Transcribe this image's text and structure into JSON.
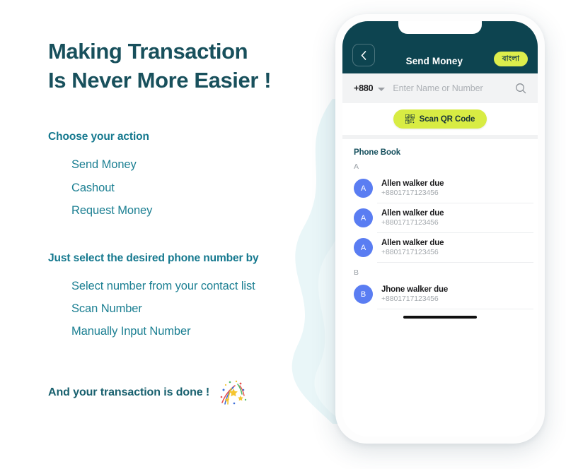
{
  "colors": {
    "headline": "#18505c",
    "section_title": "#14788e",
    "list_item": "#1b7f92",
    "closing": "#18606e",
    "app_header_bg": "#0d4450",
    "accent_lime": "#d8ec43",
    "lang_pill_bg": "#ddee4c",
    "avatar_blue": "#5a7df2",
    "background_blob": "#eaf6f8"
  },
  "left": {
    "headline": "Making Transaction\nIs Never More Easier !",
    "sections": [
      {
        "title": "Choose your action",
        "items": [
          "Send Money",
          "Cashout",
          "Request Money"
        ]
      },
      {
        "title": "Just select the desired phone number by",
        "items": [
          "Select number from your contact list",
          "Scan Number",
          "Manually Input Number"
        ]
      }
    ],
    "closing_text": "And your transaction is done !",
    "closing_icon": "confetti-icon"
  },
  "phone": {
    "header": {
      "back_icon": "chevron-left-icon",
      "title": "Send Money",
      "language_pill": "বাংলা"
    },
    "search": {
      "country_code": "+880",
      "caret_icon": "chevron-down-icon",
      "placeholder": "Enter Name or Number",
      "value": "",
      "search_icon": "search-icon"
    },
    "qr": {
      "icon": "qr-code-icon",
      "label": "Scan QR Code"
    },
    "phonebook": {
      "title": "Phone Book",
      "groups": [
        {
          "letter": "A",
          "contacts": [
            {
              "initial": "A",
              "name": "Allen walker due",
              "number": "+8801717123456"
            },
            {
              "initial": "A",
              "name": "Allen walker due",
              "number": "+8801717123456"
            },
            {
              "initial": "A",
              "name": "Allen walker due",
              "number": "+8801717123456"
            }
          ]
        },
        {
          "letter": "B",
          "contacts": [
            {
              "initial": "B",
              "name": "Jhone walker due",
              "number": "+8801717123456"
            }
          ]
        }
      ]
    },
    "home_indicator": "home-indicator"
  }
}
